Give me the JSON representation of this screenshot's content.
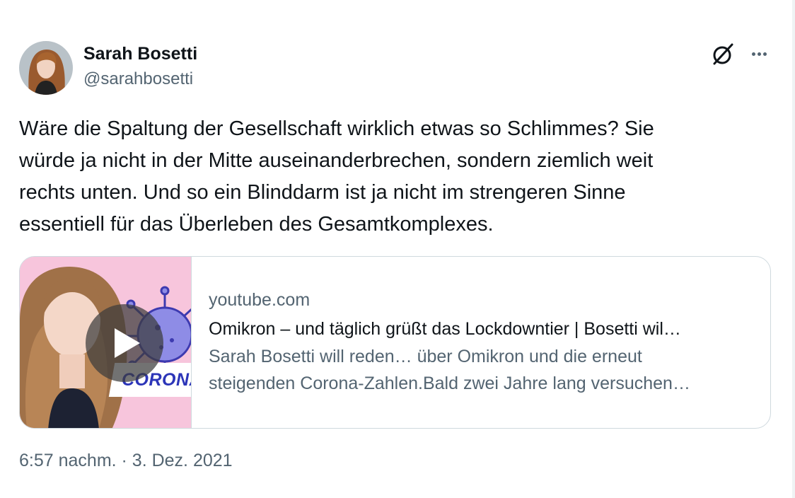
{
  "author": {
    "display_name": "Sarah Bosetti",
    "handle": "@sarahbosetti"
  },
  "header_icons": {
    "grok": "grok-icon",
    "more": "more-icon"
  },
  "tweet": {
    "text_lines": [
      "Wäre die Spaltung der Gesellschaft wirklich etwas so Schlimmes? Sie",
      "würde ja nicht in der Mitte auseinanderbrechen, sondern ziemlich weit",
      "rechts unten. Und so ein Blinddarm ist ja nicht im strengeren Sinne",
      "essentiell für das Überleben des Gesamtkomplexes."
    ],
    "timestamp": "6:57 nachm. · 3. Dez. 2021"
  },
  "link_card": {
    "domain": "youtube.com",
    "title": "Omikron – und täglich grüßt das Lockdowntier | Bosetti wil…",
    "description_lines": [
      "Sarah Bosetti will reden… über Omikron und die erneut",
      "steigenden Corona-Zahlen.Bald zwei Jahre lang versuchen…"
    ],
    "thumbnail_label": "CORONA"
  },
  "colors": {
    "text_primary": "#0f1419",
    "text_secondary": "#536471",
    "border": "#cfd9de",
    "thumb_bg": "#f7c5dc",
    "corona_blue": "#2c35b8"
  }
}
